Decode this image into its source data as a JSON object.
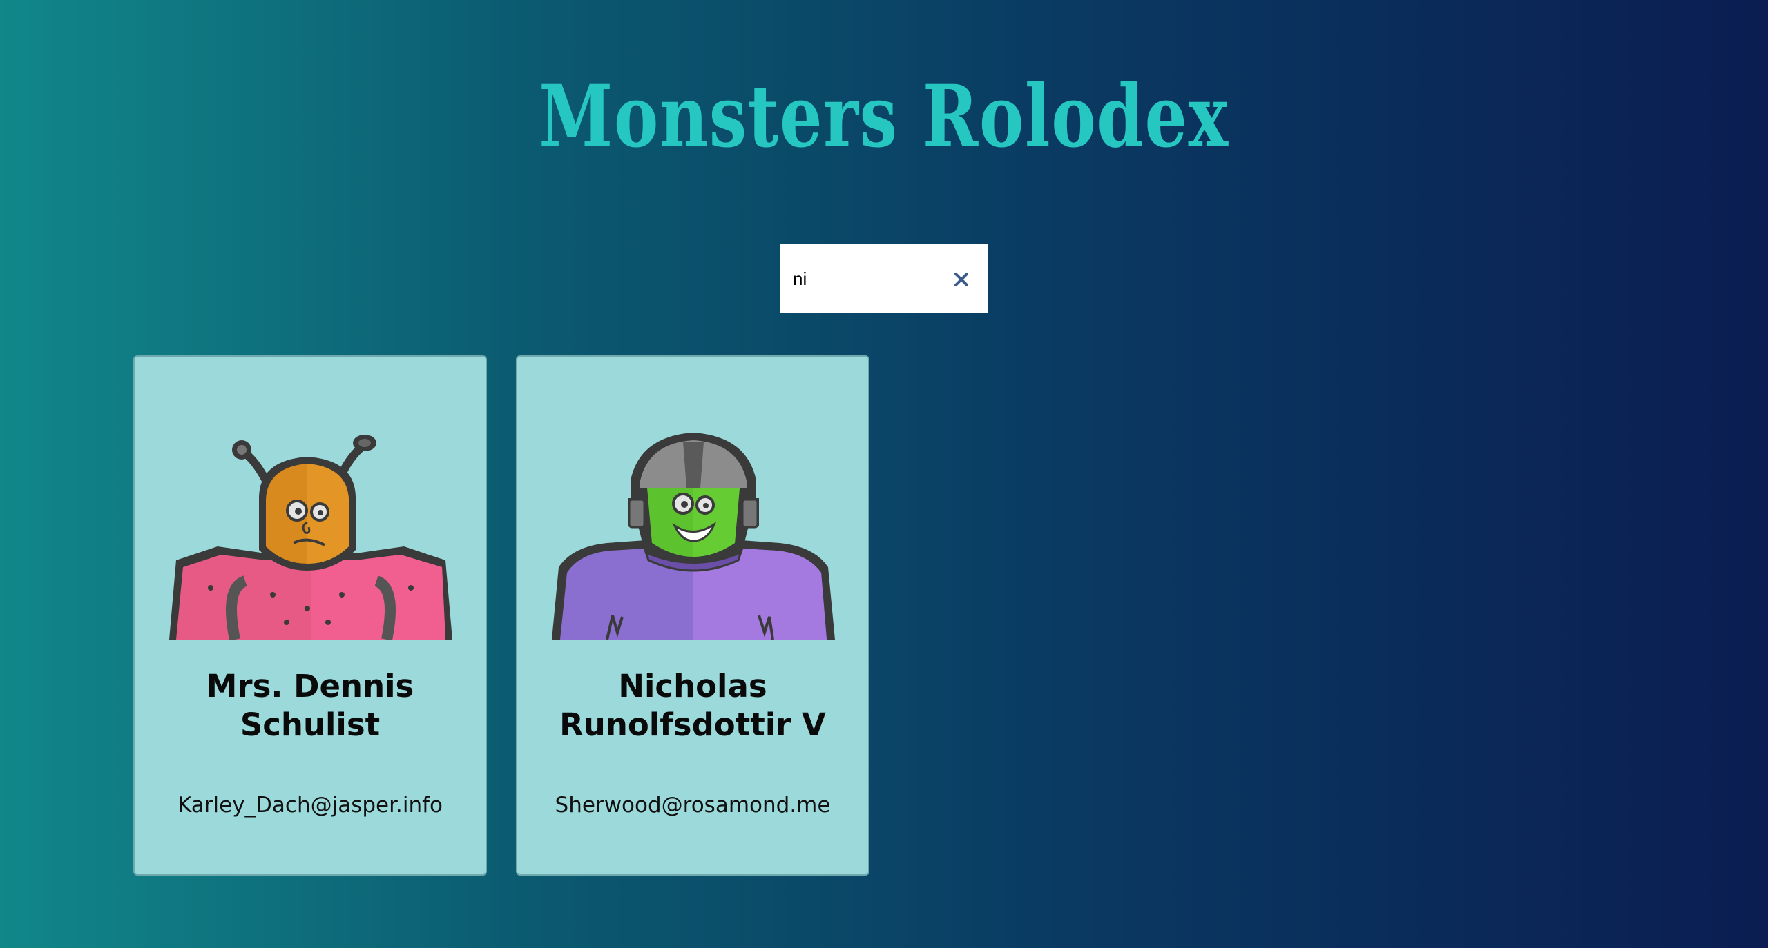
{
  "app": {
    "title": "Monsters Rolodex"
  },
  "search": {
    "value": "ni",
    "clear_icon": "close-icon"
  },
  "monsters": [
    {
      "name_line1": "Mrs. Dennis",
      "name_line2": "Schulist",
      "email": "Karley_Dach@jasper.info",
      "avatar_icon": "robot-avatar-orange"
    },
    {
      "name_line1": "Nicholas",
      "name_line2": "Runolfsdottir V",
      "email": "Sherwood@rosamond.me",
      "avatar_icon": "robot-avatar-green"
    }
  ],
  "colors": {
    "title": "#26c7c1",
    "card_background": "#9bd9da",
    "clear_icon": "#3b5b8c"
  }
}
